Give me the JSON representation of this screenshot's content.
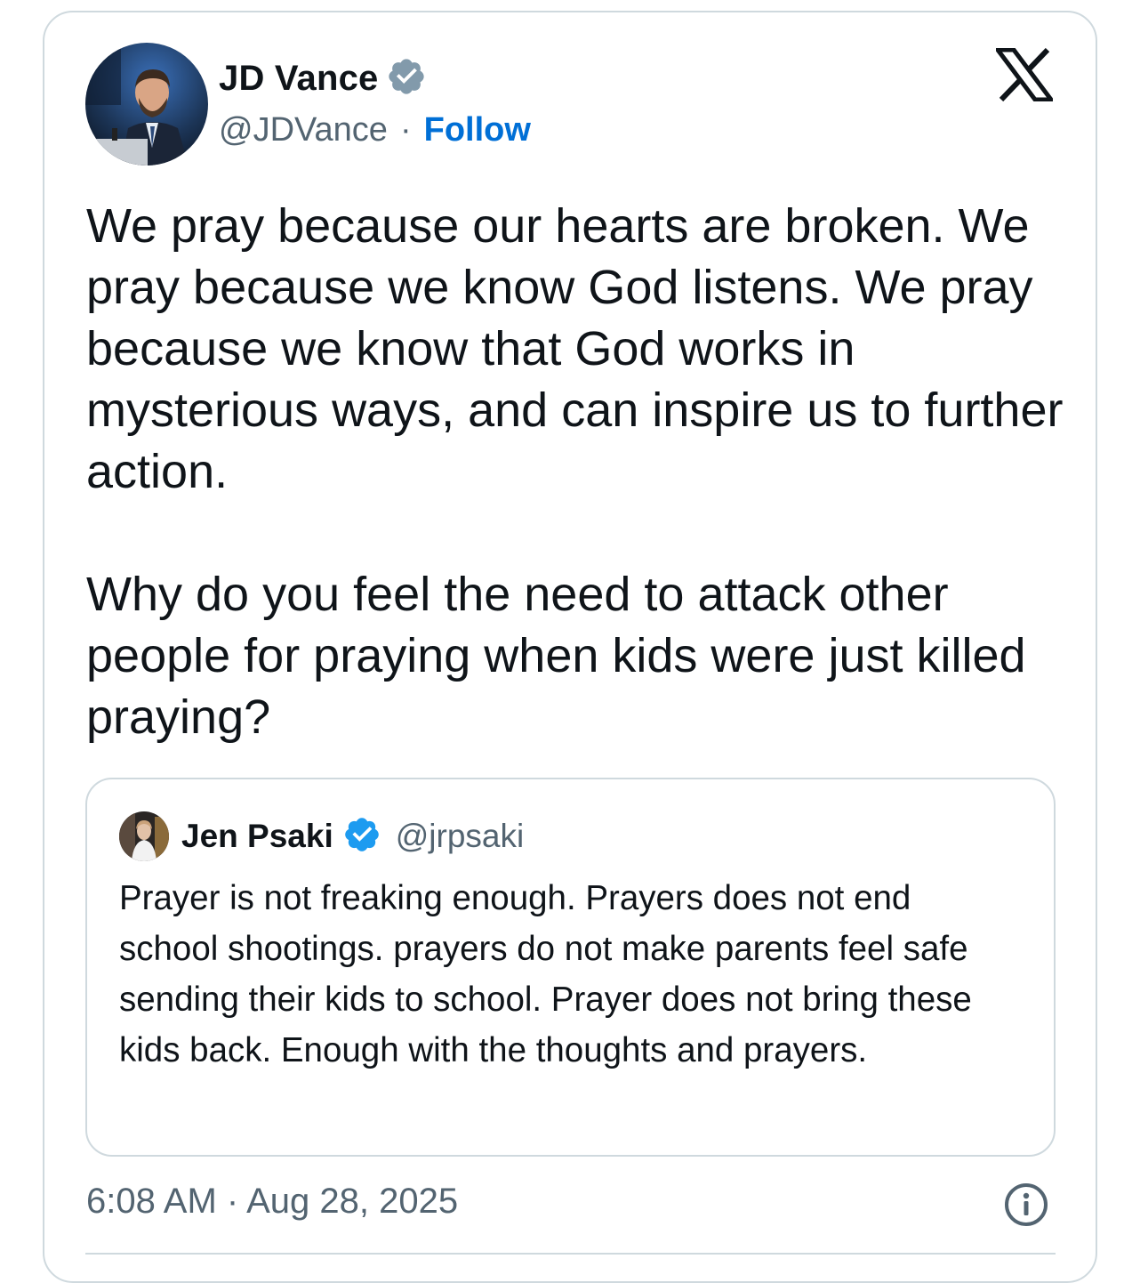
{
  "tweet": {
    "author": {
      "name": "JD Vance",
      "handle": "@JDVance",
      "separator": "·",
      "follow_label": "Follow",
      "verified": true,
      "badge_color": "#829aab"
    },
    "text": "We pray because our hearts are broken. We pray because we know God listens. We pray because we know that God works in mysterious ways, and can inspire us to further action.\n\nWhy do you feel the need to attack other people for praying when kids were just killed praying?",
    "timestamp": "6:08 AM · Aug 28, 2025",
    "platform_icon": "x-logo-icon"
  },
  "quoted_tweet": {
    "author": {
      "name": "Jen Psaki",
      "handle": "@jrpsaki",
      "verified": true,
      "badge_color": "#1d9bf0"
    },
    "text": "Prayer is not freaking enough.  Prayers does not end school shootings. prayers do not make parents feel safe sending their kids to school. Prayer does not bring these kids back. Enough with the thoughts and prayers."
  },
  "colors": {
    "follow": "#006fd6",
    "secondary_text": "#536471",
    "border": "#cfd9de"
  }
}
